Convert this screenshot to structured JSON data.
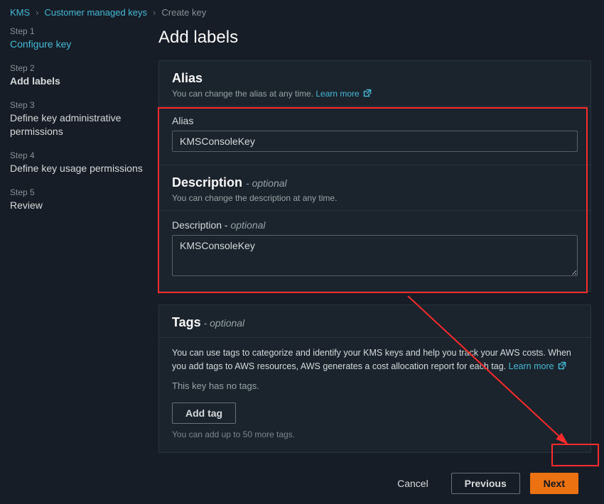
{
  "breadcrumb": {
    "items": [
      "KMS",
      "Customer managed keys",
      "Create key"
    ]
  },
  "sidebar": {
    "steps": [
      {
        "num": "Step 1",
        "label": "Configure key"
      },
      {
        "num": "Step 2",
        "label": "Add labels"
      },
      {
        "num": "Step 3",
        "label": "Define key administrative permissions"
      },
      {
        "num": "Step 4",
        "label": "Define key usage permissions"
      },
      {
        "num": "Step 5",
        "label": "Review"
      }
    ]
  },
  "page": {
    "title": "Add labels"
  },
  "alias": {
    "panel_title": "Alias",
    "sub": "You can change the alias at any time. ",
    "learn_more": "Learn more",
    "field_label": "Alias",
    "value": "KMSConsoleKey"
  },
  "description": {
    "panel_title": "Description",
    "optional": "- optional",
    "sub": "You can change the description at any time.",
    "field_label": "Description - ",
    "field_optional": "optional",
    "value": "KMSConsoleKey"
  },
  "tags": {
    "panel_title": "Tags",
    "optional": " - optional",
    "helper": "You can use tags to categorize and identify your KMS keys and help you track your AWS costs. When you add tags to AWS resources, AWS generates a cost allocation report for each tag. ",
    "learn_more": "Learn more",
    "empty": "This key has no tags.",
    "add_btn": "Add tag",
    "limit": "You can add up to 50 more tags."
  },
  "actions": {
    "cancel": "Cancel",
    "previous": "Previous",
    "next": "Next"
  }
}
